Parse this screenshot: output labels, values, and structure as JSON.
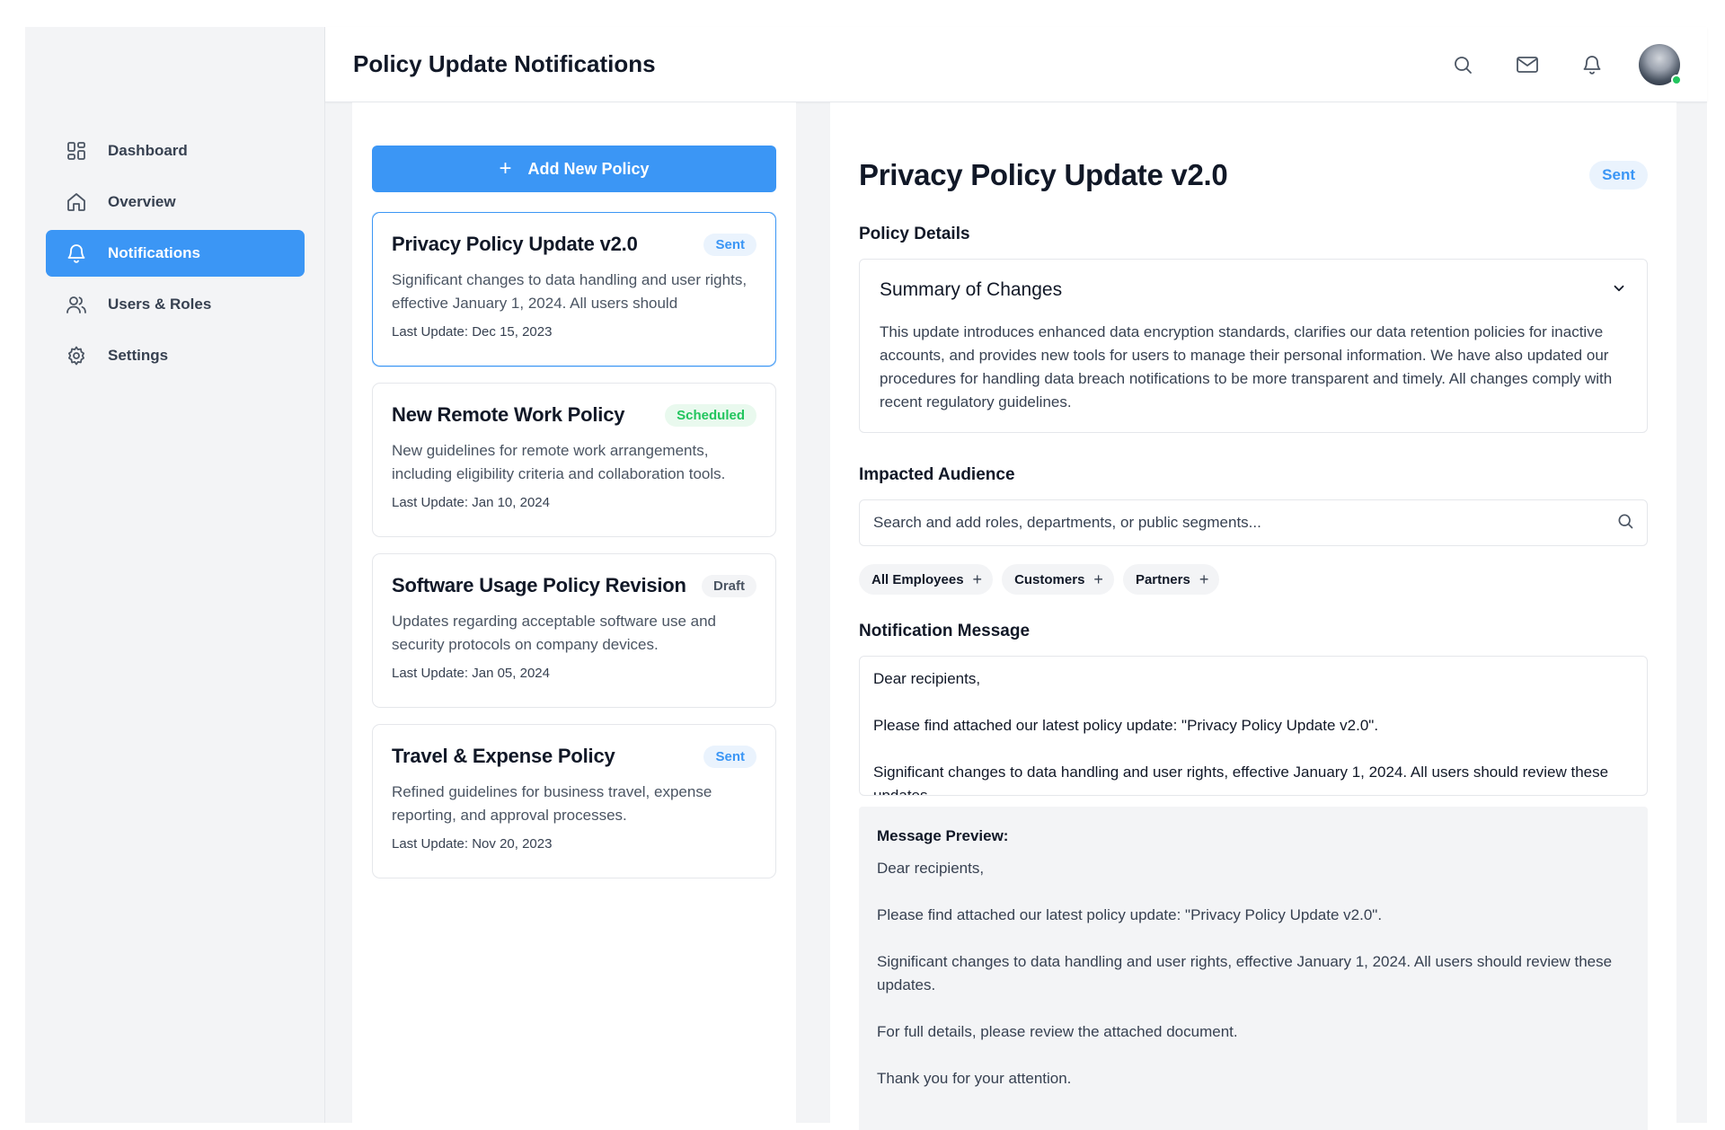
{
  "header": {
    "title": "Policy Update Notifications"
  },
  "sidebar": {
    "items": [
      {
        "label": "Dashboard",
        "icon": "dashboard-icon"
      },
      {
        "label": "Overview",
        "icon": "home-icon"
      },
      {
        "label": "Notifications",
        "icon": "bell-icon",
        "active": true
      },
      {
        "label": "Users & Roles",
        "icon": "users-icon"
      },
      {
        "label": "Settings",
        "icon": "gear-icon"
      }
    ]
  },
  "list": {
    "add_button_label": "Add New Policy",
    "policies": [
      {
        "title": "Privacy Policy Update v2.0",
        "status": "Sent",
        "description": "Significant changes to data handling and user rights, effective January 1, 2024. All users should",
        "last_update": "Last Update: Dec 15, 2023"
      },
      {
        "title": "New Remote Work Policy",
        "status": "Scheduled",
        "description": "New guidelines for remote work arrangements, including eligibility criteria and collaboration tools.",
        "last_update": "Last Update: Jan 10, 2024"
      },
      {
        "title": "Software Usage Policy Revision",
        "status": "Draft",
        "description": "Updates regarding acceptable software use and security protocols on company devices.",
        "last_update": "Last Update: Jan 05, 2024"
      },
      {
        "title": "Travel & Expense Policy",
        "status": "Sent",
        "description": "Refined guidelines for business travel, expense reporting, and approval processes.",
        "last_update": "Last Update: Nov 20, 2023"
      }
    ]
  },
  "detail": {
    "title": "Privacy Policy Update v2.0",
    "status": "Sent",
    "policy_details_label": "Policy Details",
    "summary_title": "Summary of Changes",
    "summary_text": "This update introduces enhanced data encryption standards, clarifies our data retention policies for inactive accounts, and provides new tools for users to manage their personal information. We have also updated our procedures for handling data breach notifications to be more transparent and timely. All changes comply with recent regulatory guidelines.",
    "audience_label": "Impacted Audience",
    "audience_placeholder": "Search and add roles, departments, or public segments...",
    "audience_chips": [
      "All Employees",
      "Customers",
      "Partners"
    ],
    "message_label": "Notification Message",
    "message_text": "Dear recipients,\n\nPlease find attached our latest policy update: \"Privacy Policy Update v2.0\".\n\nSignificant changes to data handling and user rights, effective January 1, 2024. All users should review these updates.",
    "preview_label": "Message Preview:",
    "preview_text": "Dear recipients,\n\nPlease find attached our latest policy update: \"Privacy Policy Update v2.0\".\n\nSignificant changes to data handling and user rights, effective January 1, 2024. All users should review these updates.\n\nFor full details, please review the attached document.\n\nThank you for your attention."
  },
  "colors": {
    "accent": "#3b96f5",
    "scheduled": "#22c55e",
    "online": "#22c55e"
  }
}
